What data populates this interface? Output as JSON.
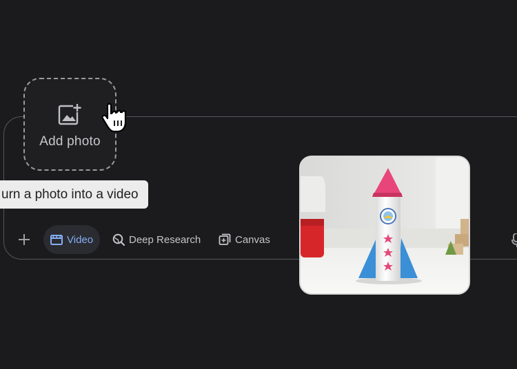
{
  "add_photo": {
    "label": "Add photo",
    "icon": "add-photo-icon"
  },
  "tooltip": {
    "text": "urn a photo into a video"
  },
  "toolbar": {
    "plus_icon": "plus-icon",
    "video_label": "Video",
    "deep_research_label": "Deep Research",
    "canvas_label": "Canvas"
  },
  "colors": {
    "background": "#1b1b1d",
    "accent": "#86aef5",
    "tooltip_bg": "#ececec",
    "rocket_cone": "#e8457a",
    "rocket_fins": "#3b8fd6"
  },
  "photo": {
    "subject": "rocket-craft-photo"
  }
}
